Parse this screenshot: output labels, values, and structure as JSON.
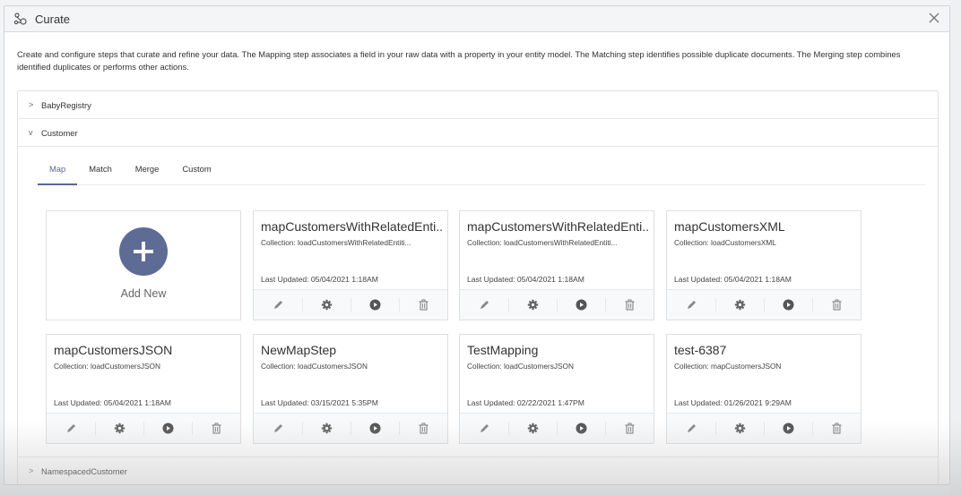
{
  "modal": {
    "title": "Curate",
    "icon": "curate-flow-icon",
    "close_icon": "close-icon",
    "description": "Create and configure steps that curate and refine your data. The Mapping step associates a field in your raw data with a property in your entity model. The Matching step identifies possible duplicate documents. The Merging step combines identified duplicates or performs other actions."
  },
  "entities": [
    {
      "name": "BabyRegistry",
      "expanded": false,
      "arrow": ">"
    },
    {
      "name": "Customer",
      "expanded": true,
      "arrow": "v"
    },
    {
      "name": "NamespacedCustomer",
      "expanded": false,
      "arrow": ">"
    }
  ],
  "tabs": [
    {
      "label": "Map",
      "active": true
    },
    {
      "label": "Match",
      "active": false
    },
    {
      "label": "Merge",
      "active": false
    },
    {
      "label": "Custom",
      "active": false
    }
  ],
  "add_new": {
    "label": "Add New",
    "icon": "plus-icon"
  },
  "cards": [
    {
      "title": "mapCustomersWithRelatedEnti...",
      "collection": "Collection: loadCustomersWithRelatedEntiti...",
      "updated": "Last Updated: 05/04/2021 1:18AM"
    },
    {
      "title": "mapCustomersWithRelatedEnti...",
      "collection": "Collection: loadCustomersWithRelatedEntiti...",
      "updated": "Last Updated: 05/04/2021 1:18AM"
    },
    {
      "title": "mapCustomersXML",
      "collection": "Collection: loadCustomersXML",
      "updated": "Last Updated: 05/04/2021 1:18AM"
    },
    {
      "title": "mapCustomersJSON",
      "collection": "Collection: loadCustomersJSON",
      "updated": "Last Updated: 05/04/2021 1:18AM"
    },
    {
      "title": "NewMapStep",
      "collection": "Collection: loadCustomersJSON",
      "updated": "Last Updated: 03/15/2021 5:35PM"
    },
    {
      "title": "TestMapping",
      "collection": "Collection: loadCustomersJSON",
      "updated": "Last Updated: 02/22/2021 1:47PM"
    },
    {
      "title": "test-6387",
      "collection": "Collection: mapCustomersJSON",
      "updated": "Last Updated: 01/26/2021 9:29AM"
    }
  ],
  "card_actions": [
    "edit-icon",
    "settings-icon",
    "run-icon",
    "delete-icon"
  ],
  "colors": {
    "accent": "#5e6b95",
    "tab_active": "#5b6696"
  }
}
